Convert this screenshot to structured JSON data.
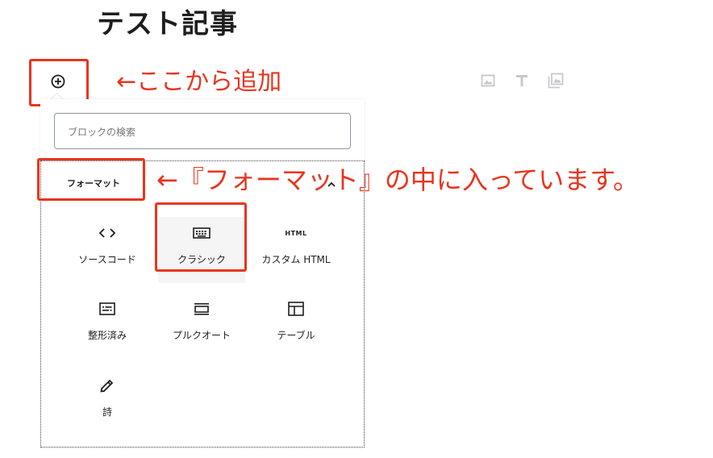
{
  "post": {
    "title": "テスト記事"
  },
  "annotations": {
    "add_here": "←ここから追加",
    "inside_formatting": "←『フォーマット』の中に入っています。"
  },
  "inserter": {
    "search_placeholder": "ブロックの検索",
    "category_label": "フォーマット",
    "blocks": [
      {
        "label": "ソースコード",
        "icon": "code-icon"
      },
      {
        "label": "クラシック",
        "icon": "keyboard-icon"
      },
      {
        "label": "カスタム HTML",
        "icon": "html-icon",
        "icon_text": "HTML"
      },
      {
        "label": "整形済み",
        "icon": "preformatted-icon"
      },
      {
        "label": "プルクオート",
        "icon": "pullquote-icon"
      },
      {
        "label": "テーブル",
        "icon": "table-icon"
      },
      {
        "label": "詩",
        "icon": "pencil-icon"
      }
    ]
  },
  "colors": {
    "annotation": "#e8351f",
    "icon_gray": "#c5c9ce",
    "text": "#1e1e1e"
  }
}
